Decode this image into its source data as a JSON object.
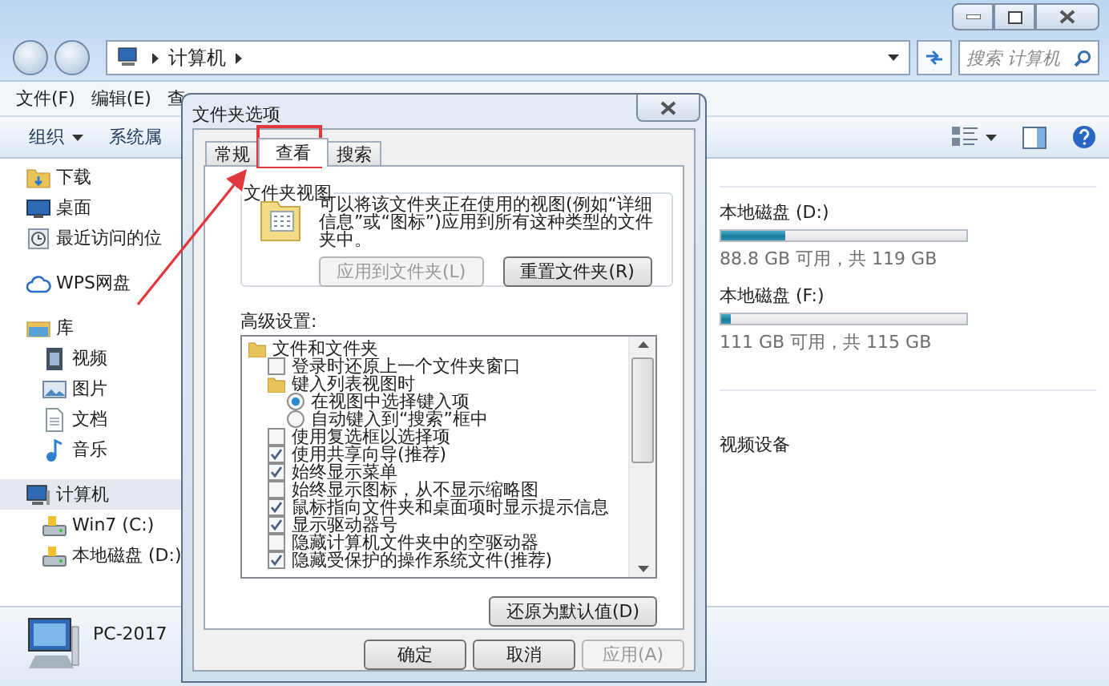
{
  "address_bar": {
    "path": [
      "计算机"
    ]
  },
  "search": {
    "placeholder": "搜索 计算机"
  },
  "menu": [
    {
      "label": "文件(F)"
    },
    {
      "label": "编辑(E)"
    },
    {
      "label": "查"
    }
  ],
  "toolbar": [
    {
      "label": "组织",
      "kind": "dropdown"
    },
    {
      "label": "系统属",
      "kind": "plain"
    }
  ],
  "navigation": [
    {
      "items": [
        {
          "label": "下载",
          "kind": "download",
          "selected": false
        },
        {
          "label": "桌面",
          "kind": "desktop",
          "selected": false
        },
        {
          "label": "最近访问的位",
          "kind": "recent",
          "selected": false
        }
      ]
    },
    {
      "items": [
        {
          "label": "WPS网盘",
          "kind": "cloud",
          "selected": false
        }
      ]
    },
    {
      "items": [
        {
          "label": "库",
          "kind": "library",
          "selected": false
        },
        {
          "label": "视频",
          "kind": "video",
          "selected": false
        },
        {
          "label": "图片",
          "kind": "picture",
          "selected": false
        },
        {
          "label": "文档",
          "kind": "document",
          "selected": false
        },
        {
          "label": "音乐",
          "kind": "music",
          "selected": false
        }
      ]
    },
    {
      "items": [
        {
          "label": "计算机",
          "kind": "computer",
          "selected": true
        },
        {
          "label": "Win7 (C:)",
          "kind": "drive",
          "selected": false
        },
        {
          "label": "本地磁盘 (D:)",
          "kind": "drive",
          "selected": false
        }
      ]
    }
  ],
  "drives": [
    {
      "name": "本地磁盘 (D:)",
      "level": 0.26,
      "space": "88.8 GB 可用，共 119 GB"
    },
    {
      "name": "本地磁盘 (F:)",
      "level": 0.04,
      "space": "111 GB 可用，共 115 GB"
    }
  ],
  "devices_heading": "视频设备",
  "details": {
    "computer_name": "PC-2017"
  },
  "dialog": {
    "title": "文件夹选项",
    "tabs": [
      {
        "label": "常规",
        "selected": false
      },
      {
        "label": "查看",
        "selected": true
      },
      {
        "label": "搜索",
        "selected": false
      }
    ],
    "folder_views": {
      "title": "文件夹视图",
      "description": "可以将该文件夹正在使用的视图(例如“详细信息”或“图标”)应用到所有这种类型的文件夹中。",
      "buttons": [
        {
          "label": "应用到文件夹(L)",
          "disabled": true
        },
        {
          "label": "重置文件夹(R)",
          "disabled": false
        }
      ]
    },
    "advanced": {
      "label": "高级设置:",
      "tree": [
        {
          "kind": "folder",
          "label": "文件和文件夹",
          "children": [
            {
              "kind": "checkbox",
              "label": "登录时还原上一个文件夹窗口",
              "checked": false
            },
            {
              "kind": "folder",
              "label": "键入列表视图时",
              "children": [
                {
                  "kind": "radio",
                  "label": "在视图中选择键入项",
                  "checked": true
                },
                {
                  "kind": "radio",
                  "label": "自动键入到“搜索”框中",
                  "checked": false
                }
              ]
            },
            {
              "kind": "checkbox",
              "label": "使用复选框以选择项",
              "checked": false
            },
            {
              "kind": "checkbox",
              "label": "使用共享向导(推荐)",
              "checked": true
            },
            {
              "kind": "checkbox",
              "label": "始终显示菜单",
              "checked": true
            },
            {
              "kind": "checkbox",
              "label": "始终显示图标，从不显示缩略图",
              "checked": false
            },
            {
              "kind": "checkbox",
              "label": "鼠标指向文件夹和桌面项时显示提示信息",
              "checked": true
            },
            {
              "kind": "checkbox",
              "label": "显示驱动器号",
              "checked": true
            },
            {
              "kind": "checkbox",
              "label": "隐藏计算机文件夹中的空驱动器",
              "checked": false
            },
            {
              "kind": "checkbox",
              "label": "隐藏受保护的操作系统文件(推荐)",
              "checked": true
            }
          ]
        }
      ]
    },
    "restore_button": "还原为默认值(D)",
    "buttons": [
      {
        "label": "确定",
        "disabled": false
      },
      {
        "label": "取消",
        "disabled": false
      },
      {
        "label": "应用(A)",
        "disabled": true
      }
    ]
  }
}
